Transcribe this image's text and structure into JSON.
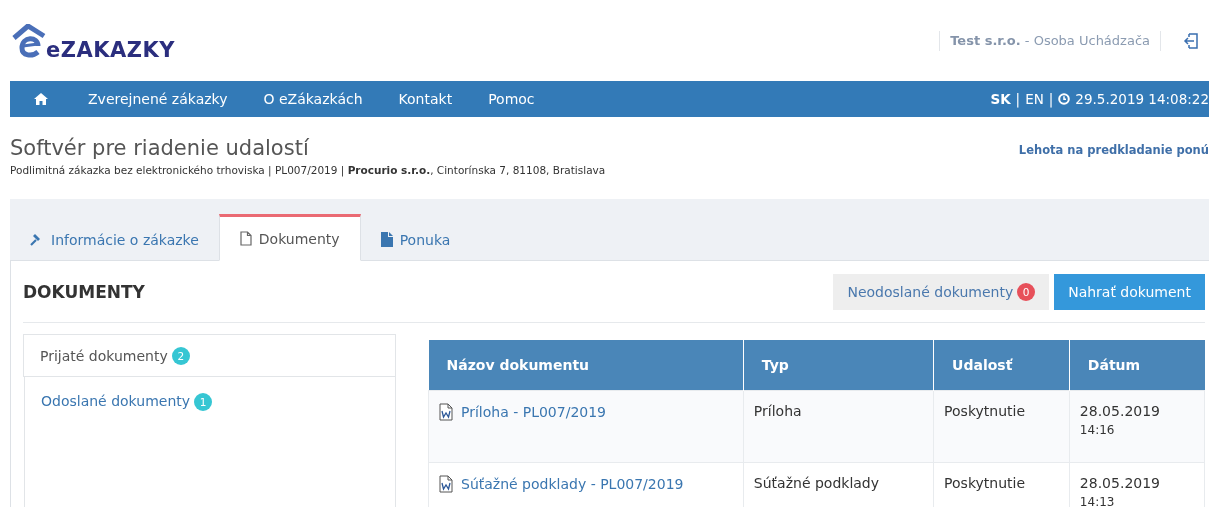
{
  "header": {
    "logo": "eZAKAZKY",
    "company": "Test s.r.o.",
    "user": "- Osoba Uchádzača"
  },
  "nav": {
    "items": [
      {
        "kind": "home"
      },
      {
        "kind": "link",
        "label": "Zverejnené zákazky"
      },
      {
        "kind": "link",
        "label": "O eZákazkách"
      },
      {
        "kind": "link",
        "label": "Kontakt"
      },
      {
        "kind": "link",
        "label": "Pomoc"
      }
    ],
    "languages": [
      {
        "label": "SK",
        "selected": true
      },
      {
        "label": "EN",
        "selected": false
      }
    ],
    "separators": [
      "|",
      "|"
    ],
    "datetime": "29.5.2019 14:08:22"
  },
  "tender": {
    "title": "Softvér pre riadenie udalostí",
    "subtitle": "Podlimitná zákazka bez elektronického trhoviska | PL007/2019 | **Procurio s.r.o.**, Cintorínska 7, 81108, Bratislava",
    "deadline": "Lehota na predkladanie ponú"
  },
  "tabs": [
    {
      "kind": "info",
      "label": "Informácie o zákazke",
      "selected": false
    },
    {
      "kind": "documents",
      "label": "Dokumenty",
      "selected": true
    },
    {
      "kind": "offer",
      "label": "Ponuka",
      "selected": false
    }
  ],
  "section": {
    "title": "DOKUMENTY",
    "buttons": [
      {
        "kind": "secondary",
        "label": "Neodoslané dokumenty",
        "count": "0"
      },
      {
        "kind": "primary",
        "label": "Nahrať dokument"
      }
    ]
  },
  "sidebar": {
    "items": [
      {
        "label": "Prijaté dokumenty",
        "count": "2",
        "selected": true
      },
      {
        "label": "Odoslané dokumenty",
        "count": "1",
        "selected": false
      }
    ]
  },
  "table": {
    "columns": [
      "Názov dokumentu",
      "Typ",
      "Udalosť",
      "Dátum"
    ],
    "rows": [
      {
        "name": "Príloha - PL007/2019",
        "type": "Príloha",
        "event": "Poskytnutie",
        "date": "28.05.2019",
        "time": "14:16"
      },
      {
        "name": "Súťažné podklady - PL007/2019",
        "type": "Súťažné podklady",
        "event": "Poskytnutie",
        "date": "28.05.2019",
        "time": "14:13"
      }
    ]
  }
}
